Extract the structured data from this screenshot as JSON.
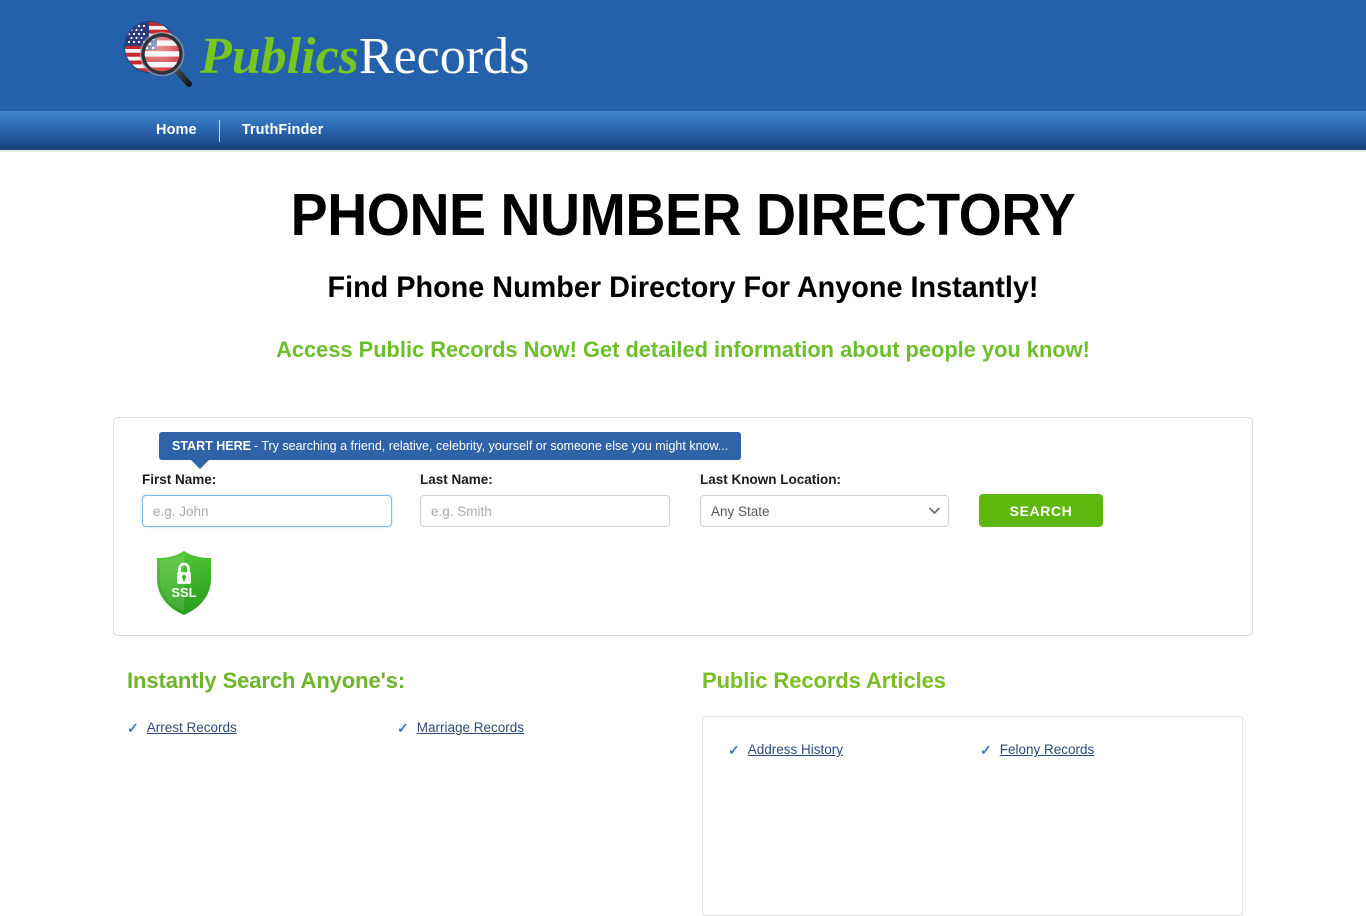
{
  "header": {
    "logo": {
      "icon": "us-flag-magnifier-icon",
      "text_green": "Publics",
      "text_white": "Records"
    },
    "background_color": "#2561ab"
  },
  "nav": {
    "items": [
      {
        "label": "Home",
        "name": "nav-link-home"
      },
      {
        "label": "TruthFinder",
        "name": "nav-link-truthfinder"
      }
    ]
  },
  "hero": {
    "title": "PHONE NUMBER DIRECTORY",
    "subtitle": "Find Phone Number Directory For Anyone Instantly!",
    "tagline": "Access Public Records Now! Get detailed information about people you know!",
    "tagline_color": "#6cbf2a"
  },
  "search_form": {
    "start_here": {
      "bold": "START HERE",
      "rest": "- Try searching a friend, relative, celebrity, yourself or someone else you might know..."
    },
    "first_name": {
      "label": "First Name:",
      "placeholder": "e.g. John",
      "value": ""
    },
    "last_name": {
      "label": "Last Name:",
      "placeholder": "e.g. Smith",
      "value": ""
    },
    "location": {
      "label": "Last Known Location:",
      "selected": "Any State",
      "options": [
        "Any State"
      ]
    },
    "search_button": "SEARCH",
    "search_button_color": "#5cb80d",
    "ssl_badge": {
      "icon": "ssl-shield-lock-icon",
      "label": "SSL"
    }
  },
  "instant_search": {
    "title": "Instantly Search Anyone's:",
    "links": [
      "Arrest Records",
      "Marriage Records"
    ]
  },
  "articles": {
    "title": "Public Records Articles",
    "links": [
      "Address History",
      "Felony Records"
    ]
  }
}
